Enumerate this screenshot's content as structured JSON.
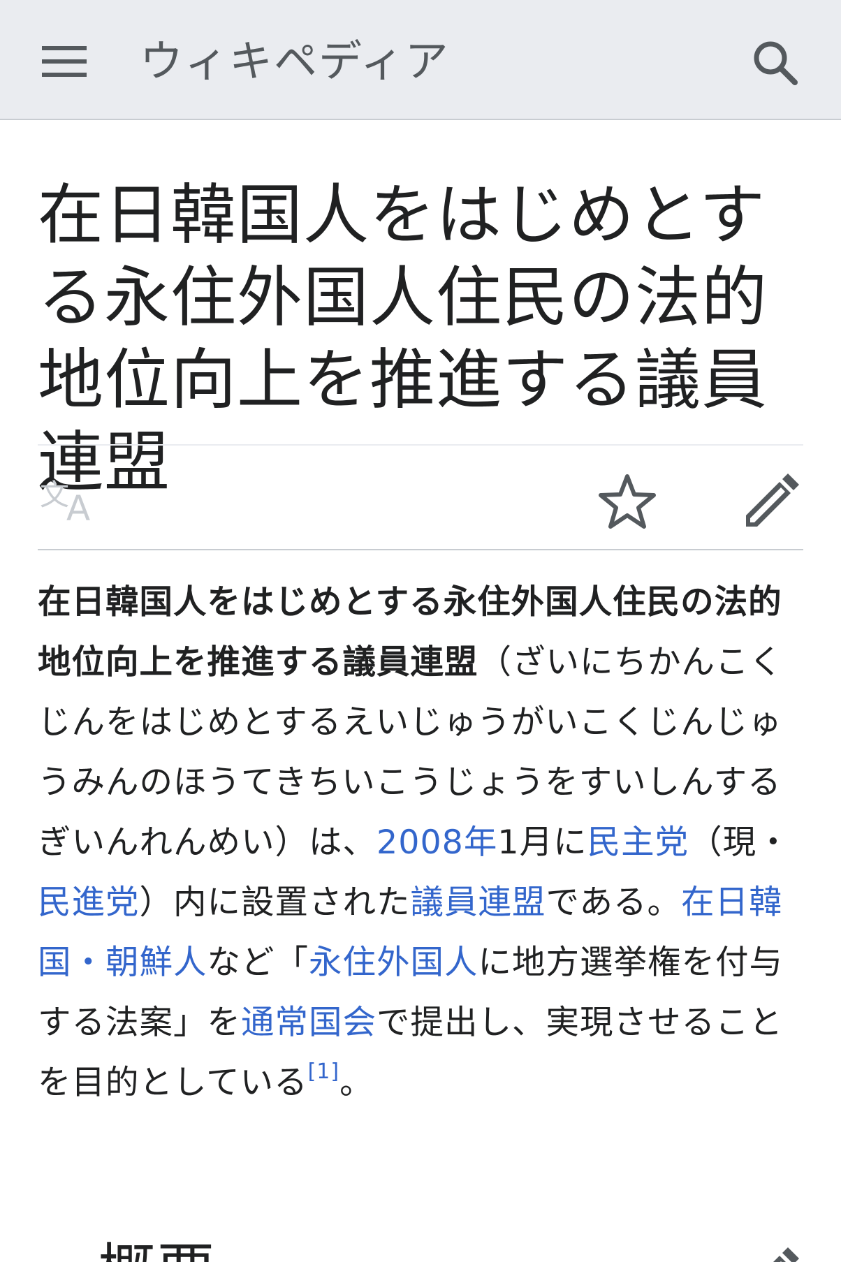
{
  "header": {
    "brand": "ウィキペディア",
    "menu_icon": "hamburger-menu-icon",
    "search_icon": "search-icon"
  },
  "article": {
    "title": "在日韓国人をはじめとする永住外国人住民の法的地位向上を推進する議員連盟"
  },
  "actions": {
    "language_icon": "language-icon",
    "watch_icon": "star-icon",
    "edit_icon": "pencil-icon"
  },
  "intro": {
    "bold_title": "在日韓国人をはじめとする永住外国人住民の法的地位向上を推進する議員連盟",
    "reading": "（ざいにちかんこくじんをはじめとするえいじゅうがいこくじんじゅうみんのほうてきちいこうじょうをすいしんするぎいんれんめい）は、",
    "link_year": "2008年",
    "text_month": "1月に",
    "link_dpj": "民主党",
    "text_paren_open": "（現・",
    "link_dp": "民進党",
    "text_inside": "）内に設置された",
    "link_league": "議員連盟",
    "text_is": "である。",
    "link_zainichi": "在日韓国・朝鮮人",
    "text_etc": "など「",
    "link_permanent": "永住外国人",
    "text_bill": "に地方選挙権を付与する法案」を",
    "link_diet": "通常国会",
    "text_aim": "で提出し、実現させることを目的としている",
    "ref": "[1]",
    "text_end": "。"
  },
  "section": {
    "title": "概要",
    "chevron_icon": "chevron-down-icon",
    "edit_icon": "pencil-icon"
  },
  "colors": {
    "header_bg": "#eaecf0",
    "link": "#3366cc",
    "text": "#202122",
    "icon": "#54595d"
  }
}
